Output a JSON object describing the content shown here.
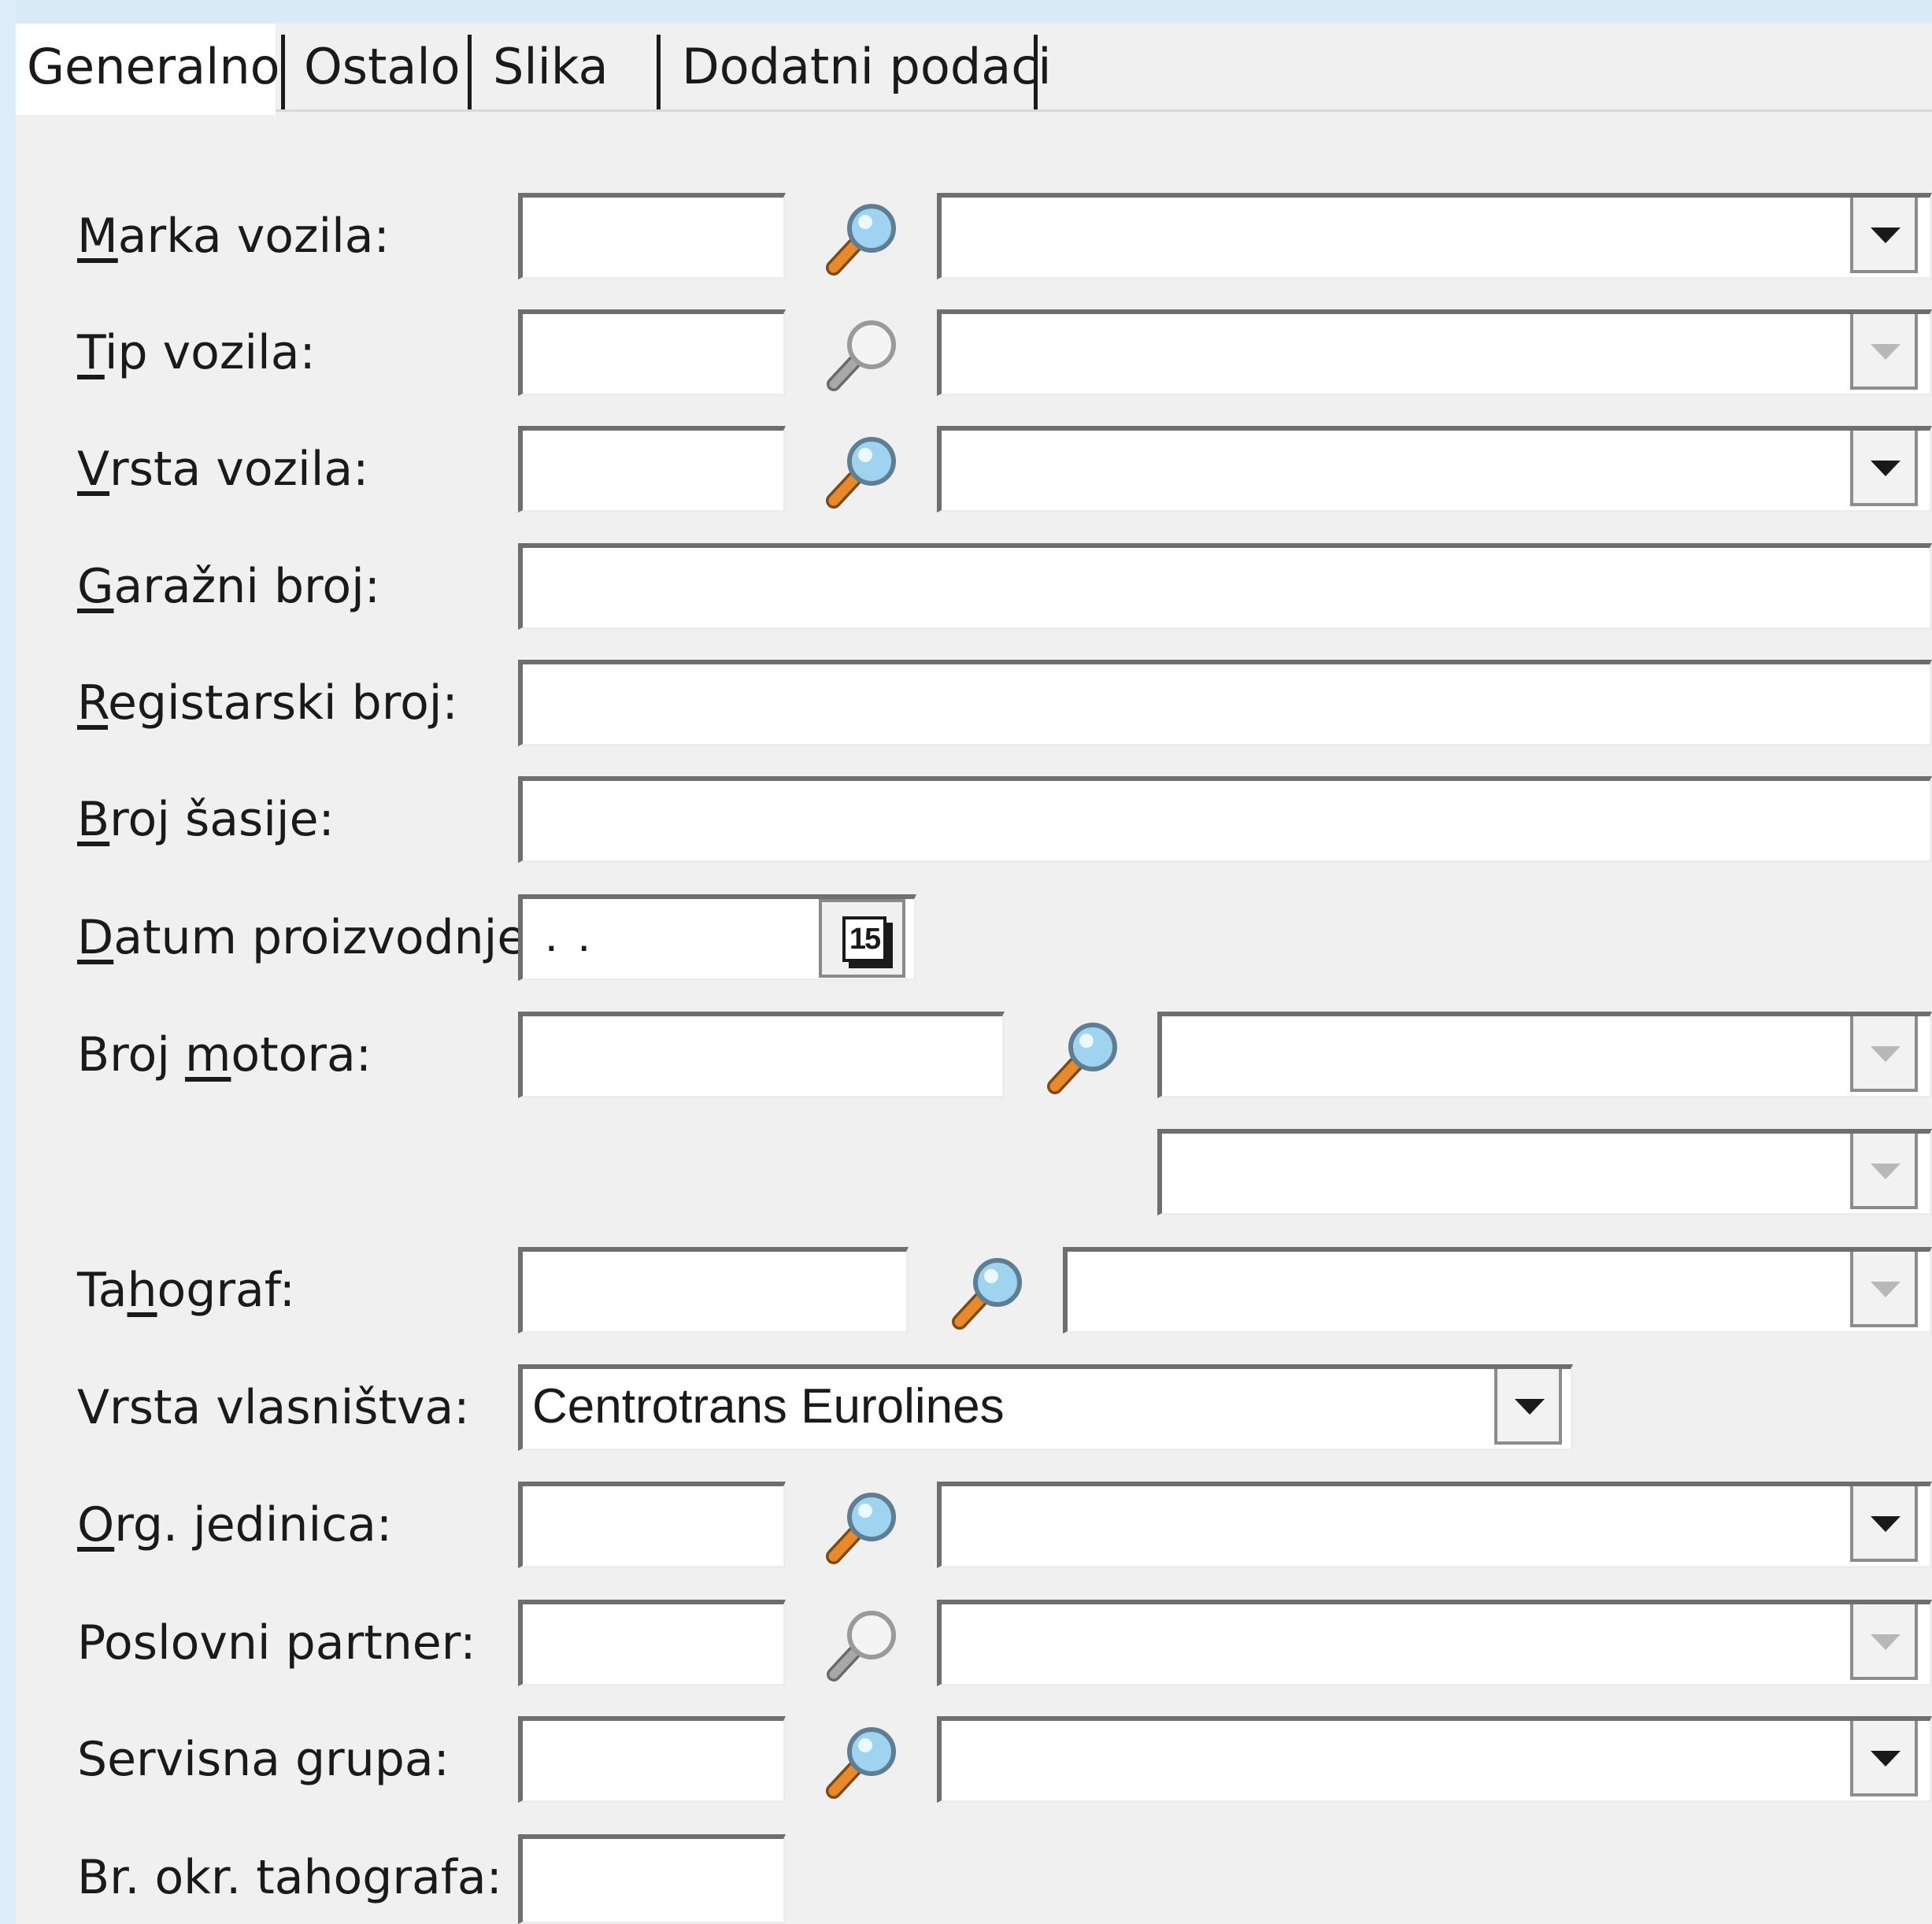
{
  "tabs": [
    {
      "label": "Generalno",
      "active": true
    },
    {
      "label": "Ostalo",
      "active": false
    },
    {
      "label": "Slika",
      "active": false
    },
    {
      "label": "Dodatni podaci",
      "active": false
    }
  ],
  "form": {
    "marka_vozila": {
      "label_pre": "",
      "label_key": "M",
      "label_post": "arka vozila:",
      "code": "",
      "name": ""
    },
    "tip_vozila": {
      "label_pre": "",
      "label_key": "T",
      "label_post": "ip vozila:",
      "code": "",
      "name": ""
    },
    "vrsta_vozila": {
      "label_pre": "",
      "label_key": "V",
      "label_post": "rsta vozila:",
      "code": "",
      "name": ""
    },
    "garazni_broj": {
      "label_pre": "",
      "label_key": "G",
      "label_post": "aražni broj:",
      "value": ""
    },
    "registarski_broj": {
      "label_pre": "",
      "label_key": "R",
      "label_post": "egistarski broj:",
      "value": ""
    },
    "broj_sasije": {
      "label_pre": "",
      "label_key": "B",
      "label_post": "roj šasije:",
      "value": ""
    },
    "datum_proizvodnje": {
      "label_pre": "",
      "label_key": "D",
      "label_post": "atum proizvodnje:",
      "value": ". .",
      "calendar_day": "15"
    },
    "broj_motora": {
      "label_pre": "Broj ",
      "label_key": "m",
      "label_post": "otora:",
      "code": "",
      "name": "",
      "name2": ""
    },
    "tahograf": {
      "label_pre": "Ta",
      "label_key": "h",
      "label_post": "ograf:",
      "code": "",
      "name": ""
    },
    "vrsta_vlasnistva": {
      "label_pre": "Vrsta vlasništva:",
      "label_key": "",
      "label_post": "",
      "selected": "Centrotrans Eurolines"
    },
    "org_jedinica": {
      "label_pre": "",
      "label_key": "O",
      "label_post": "rg. jedinica:",
      "code": "",
      "name": ""
    },
    "poslovni_partner": {
      "label_pre": "Poslovni partner:",
      "label_key": "",
      "label_post": "",
      "code": "",
      "name": ""
    },
    "servisna_grupa": {
      "label_pre": "Servisna grupa:",
      "label_key": "",
      "label_post": "",
      "code": "",
      "name": ""
    },
    "br_okr_tahografa": {
      "label_pre": "Br. okr. tahografa:",
      "label_key": "",
      "label_post": "",
      "value": ""
    }
  },
  "icons": {
    "lookup": "magnifier-icon",
    "dropdown": "chevron-down-icon",
    "calendar": "calendar-icon"
  },
  "colors": {
    "background": "#f0f0f0",
    "field": "#ffffff",
    "field_border": "#6e6e6e",
    "window_frame": "#d9ebf7",
    "magnifier_lens": "#9fd3ef",
    "magnifier_handle": "#e8892c"
  }
}
